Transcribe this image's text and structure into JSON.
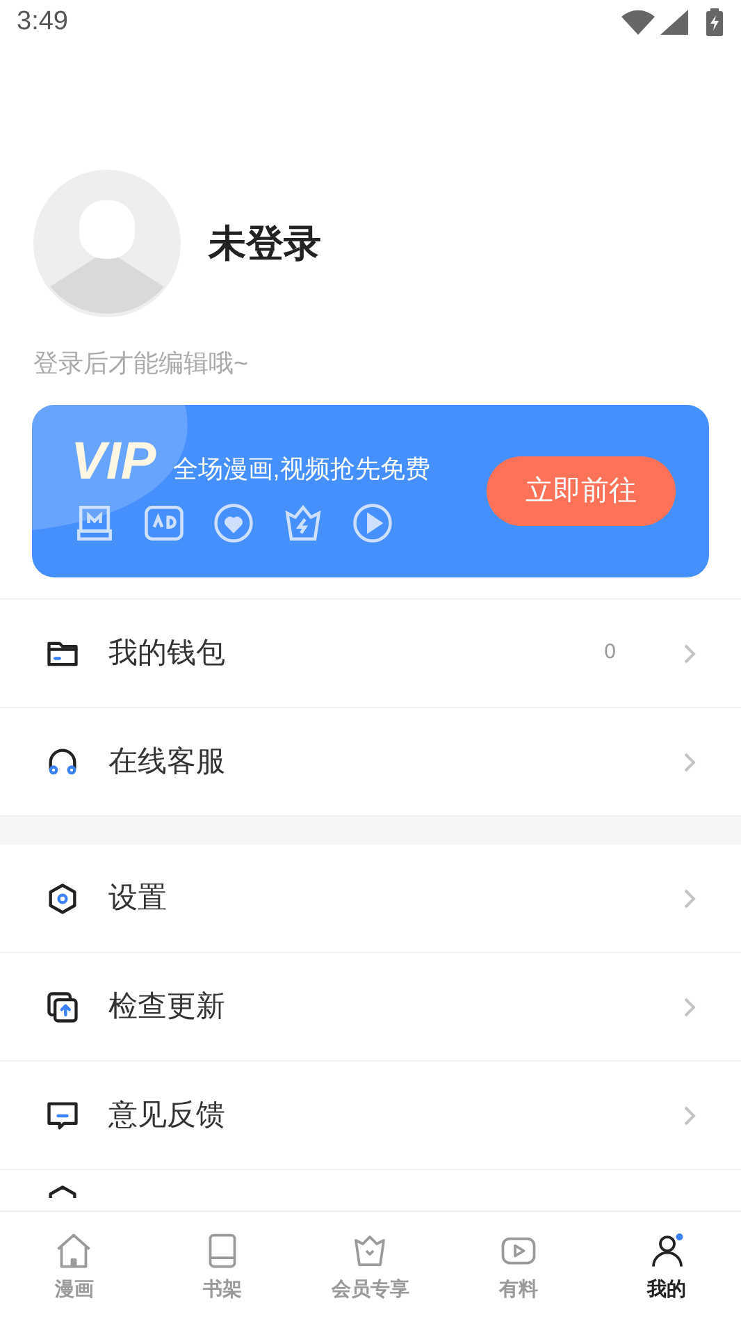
{
  "status_bar": {
    "time": "3:49"
  },
  "profile": {
    "name": "未登录",
    "hint": "登录后才能编辑哦~"
  },
  "vip_card": {
    "logo": "VIP",
    "text": "全场漫画,视频抢先免费",
    "button": "立即前往"
  },
  "menu_groups": [
    {
      "items": [
        {
          "kind": "wallet",
          "label": "我的钱包",
          "value": "0"
        },
        {
          "kind": "headset",
          "label": "在线客服"
        }
      ]
    },
    {
      "items": [
        {
          "kind": "settings",
          "label": "设置"
        },
        {
          "kind": "update",
          "label": "检查更新"
        },
        {
          "kind": "feedback",
          "label": "意见反馈"
        },
        {
          "kind": "privacy"
        }
      ]
    }
  ],
  "bottom_nav": [
    {
      "kind": "home",
      "label": "漫画",
      "selected": false
    },
    {
      "kind": "book",
      "label": "书架",
      "selected": false
    },
    {
      "kind": "crown",
      "label": "会员专享",
      "selected": false
    },
    {
      "kind": "play",
      "label": "有料",
      "selected": false
    },
    {
      "kind": "me",
      "label": "我的",
      "selected": true
    }
  ]
}
